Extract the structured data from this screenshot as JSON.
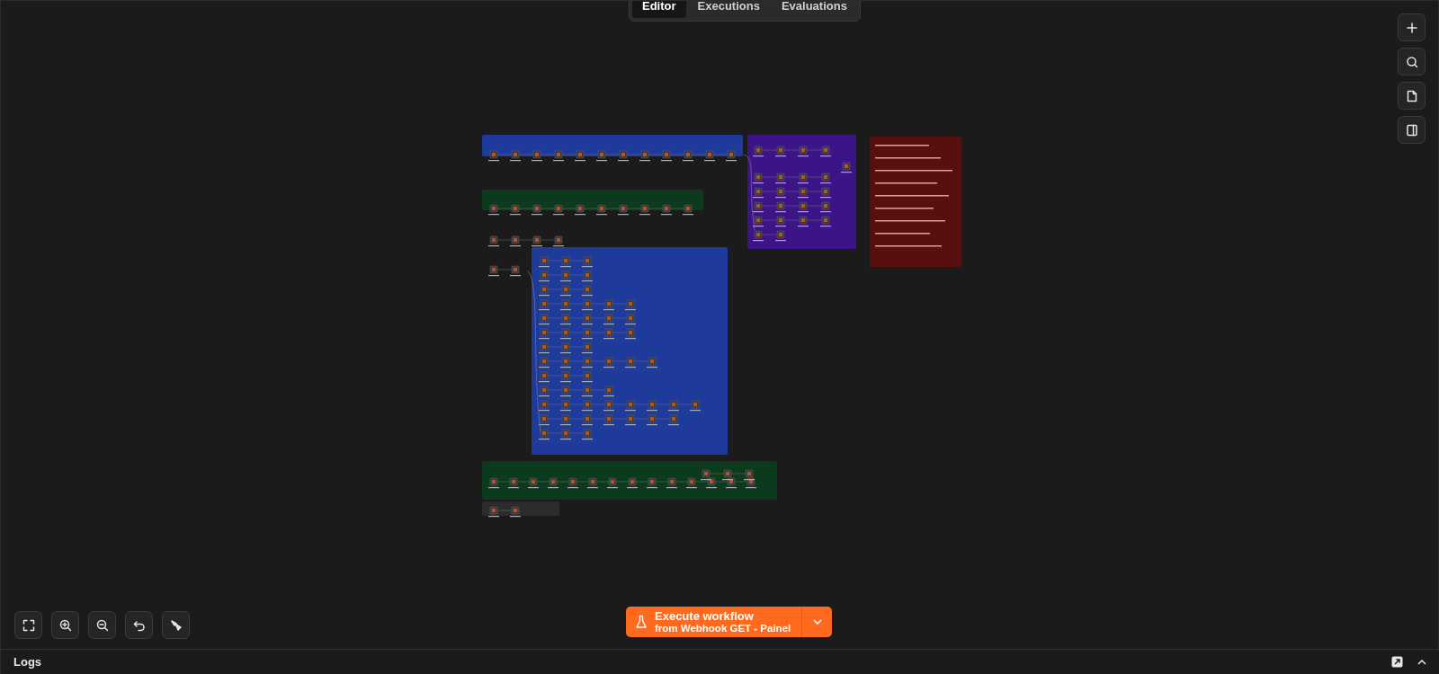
{
  "tabs": [
    {
      "label": "Editor",
      "selected": true
    },
    {
      "label": "Executions",
      "selected": false
    },
    {
      "label": "Evaluations",
      "selected": false
    }
  ],
  "execute_button": {
    "title": "Execute workflow",
    "subtitle": "from Webhook GET - Painel"
  },
  "logs_panel": {
    "title": "Logs"
  }
}
